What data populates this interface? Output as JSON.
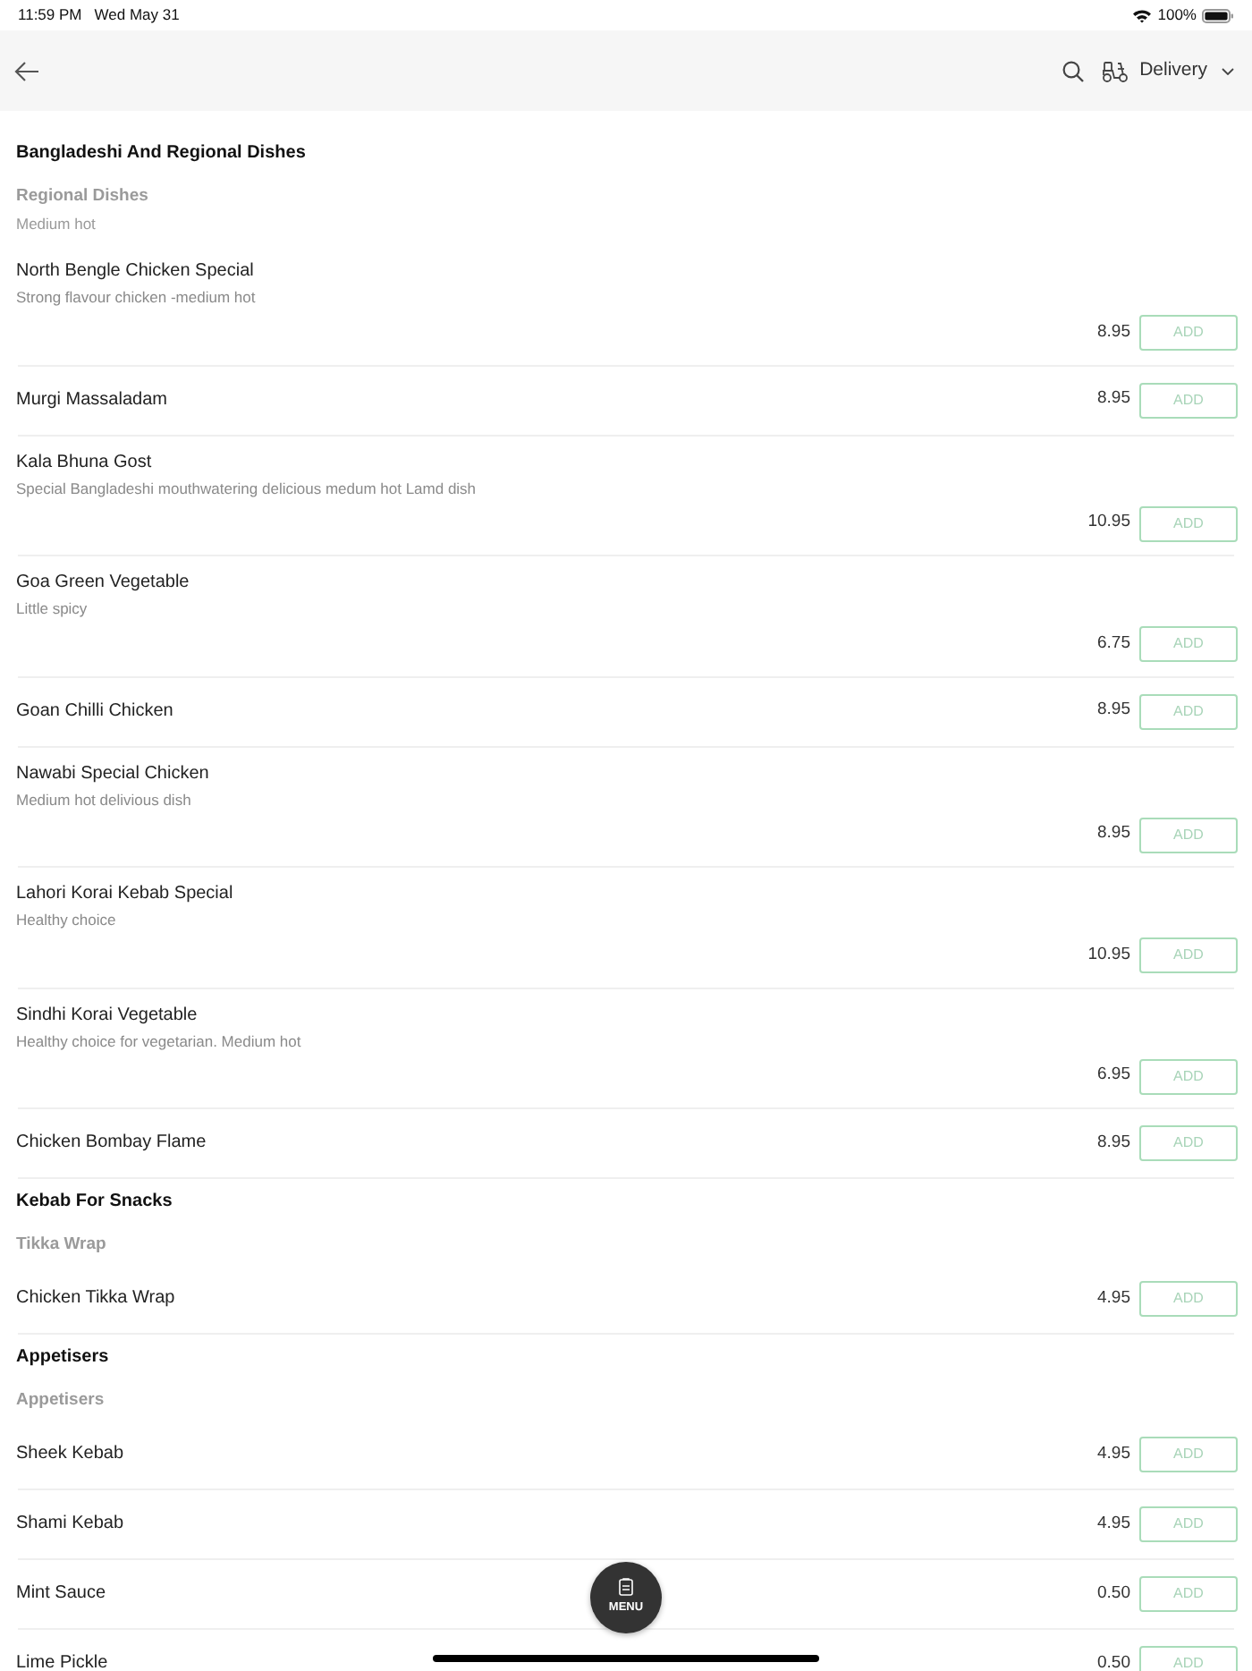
{
  "status_bar": {
    "time": "11:59 PM",
    "date": "Wed May 31",
    "battery": "100%"
  },
  "header": {
    "delivery_mode": "Delivery"
  },
  "sections": [
    {
      "title": "Bangladeshi And Regional Dishes",
      "groups": [
        {
          "title": "Regional Dishes",
          "description": "Medium hot",
          "items": [
            {
              "name": "North Bengle Chicken Special",
              "description": "Strong flavour chicken -medium hot",
              "price": "8.95",
              "action": "ADD"
            },
            {
              "name": "Murgi Massaladam",
              "price": "8.95",
              "action": "ADD"
            },
            {
              "name": "Kala Bhuna Gost",
              "description": "Special Bangladeshi mouthwatering delicious medum hot Lamd dish",
              "price": "10.95",
              "action": "ADD"
            },
            {
              "name": "Goa Green Vegetable",
              "description": "Little spicy",
              "price": "6.75",
              "action": "ADD"
            },
            {
              "name": "Goan Chilli Chicken",
              "price": "8.95",
              "action": "ADD"
            },
            {
              "name": "Nawabi Special Chicken",
              "description": "Medium hot delivious dish",
              "price": "8.95",
              "action": "ADD"
            },
            {
              "name": "Lahori Korai Kebab Special",
              "description": "Healthy choice",
              "price": "10.95",
              "action": "ADD"
            },
            {
              "name": "Sindhi Korai Vegetable",
              "description": "Healthy choice for vegetarian. Medium hot",
              "price": "6.95",
              "action": "ADD"
            },
            {
              "name": "Chicken Bombay Flame",
              "price": "8.95",
              "action": "ADD"
            }
          ]
        }
      ]
    },
    {
      "title": "Kebab For Snacks",
      "groups": [
        {
          "title": "Tikka Wrap",
          "items": [
            {
              "name": "Chicken Tikka Wrap",
              "price": "4.95",
              "action": "ADD"
            }
          ]
        }
      ]
    },
    {
      "title": "Appetisers",
      "groups": [
        {
          "title": "Appetisers",
          "items": [
            {
              "name": "Sheek Kebab",
              "price": "4.95",
              "action": "ADD"
            },
            {
              "name": "Shami Kebab",
              "price": "4.95",
              "action": "ADD"
            },
            {
              "name": "Mint Sauce",
              "price": "0.50",
              "action": "ADD"
            },
            {
              "name": "Lime Pickle",
              "price": "0.50",
              "action": "ADD"
            }
          ]
        }
      ]
    }
  ],
  "menu_button": {
    "label": "MENU"
  }
}
